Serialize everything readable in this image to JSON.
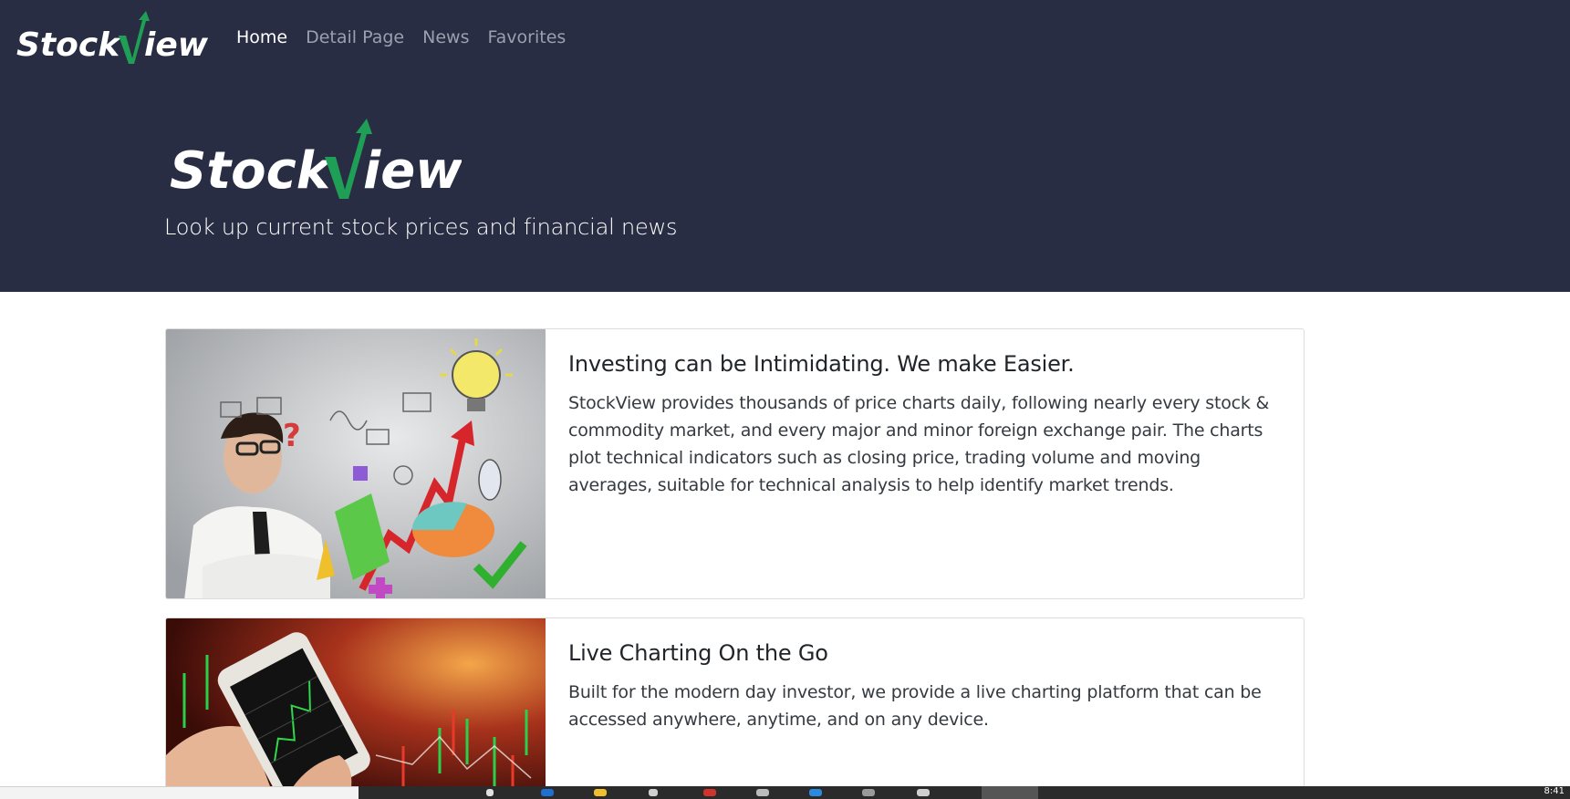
{
  "brand": {
    "logo_text_1": "Stock",
    "logo_text_2": "iew",
    "logo_accent": "V",
    "accent_color": "#1f9e55",
    "bg_color": "#282d43"
  },
  "nav": {
    "items": [
      {
        "label": "Home",
        "active": true
      },
      {
        "label": "Detail Page",
        "active": false
      },
      {
        "label": "News",
        "active": false
      },
      {
        "label": "Favorites",
        "active": false
      }
    ]
  },
  "hero": {
    "tagline": "Look up current stock prices and financial news"
  },
  "cards": [
    {
      "title": "Investing can be Intimidating. We make Easier.",
      "text": "StockView provides thousands of price charts daily, following nearly every stock & commodity market, and every major and minor foreign exchange pair. The charts plot technical indicators such as closing price, trading volume and moving averages, suitable for technical analysis to help identify market trends.",
      "image": "businessman-thinking-illustration"
    },
    {
      "title": "Live Charting On the Go",
      "text": "Built for the modern day investor, we provide a live charting platform that can be accessed anywhere, anytime, and on any device.",
      "image": "phone-stock-chart-photo"
    }
  ],
  "taskbar": {
    "clock": "8:41"
  }
}
